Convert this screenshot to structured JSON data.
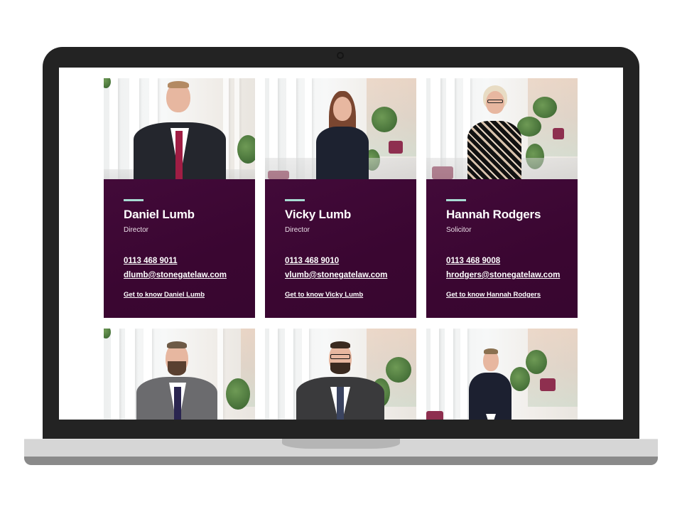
{
  "page": {
    "device": "laptop",
    "theme": {
      "panel_color": "#3c0833",
      "accent_color": "#a7dcd2",
      "text_color": "#ffffff"
    }
  },
  "team": [
    {
      "name": "Daniel Lumb",
      "role": "Director",
      "phone": "0113 468 9011",
      "email": "dlumb@stonegatelaw.com",
      "profile_link": "Get to know Daniel Lumb",
      "photo_alt": "Portrait of Daniel Lumb"
    },
    {
      "name": "Vicky Lumb",
      "role": "Director",
      "phone": "0113 468 9010",
      "email": "vlumb@stonegatelaw.com",
      "profile_link": "Get to know Vicky Lumb",
      "photo_alt": "Portrait of Vicky Lumb"
    },
    {
      "name": "Hannah Rodgers",
      "role": "Solicitor",
      "phone": "0113 468 9008",
      "email": "hrodgers@stonegatelaw.com",
      "profile_link": "Get to know Hannah Rodgers",
      "photo_alt": "Portrait of Hannah Rodgers"
    },
    {
      "photo_alt": "Portrait of team member in grey suit"
    },
    {
      "photo_alt": "Portrait of team member with glasses"
    },
    {
      "photo_alt": "Portrait of team member in navy jacket"
    }
  ]
}
